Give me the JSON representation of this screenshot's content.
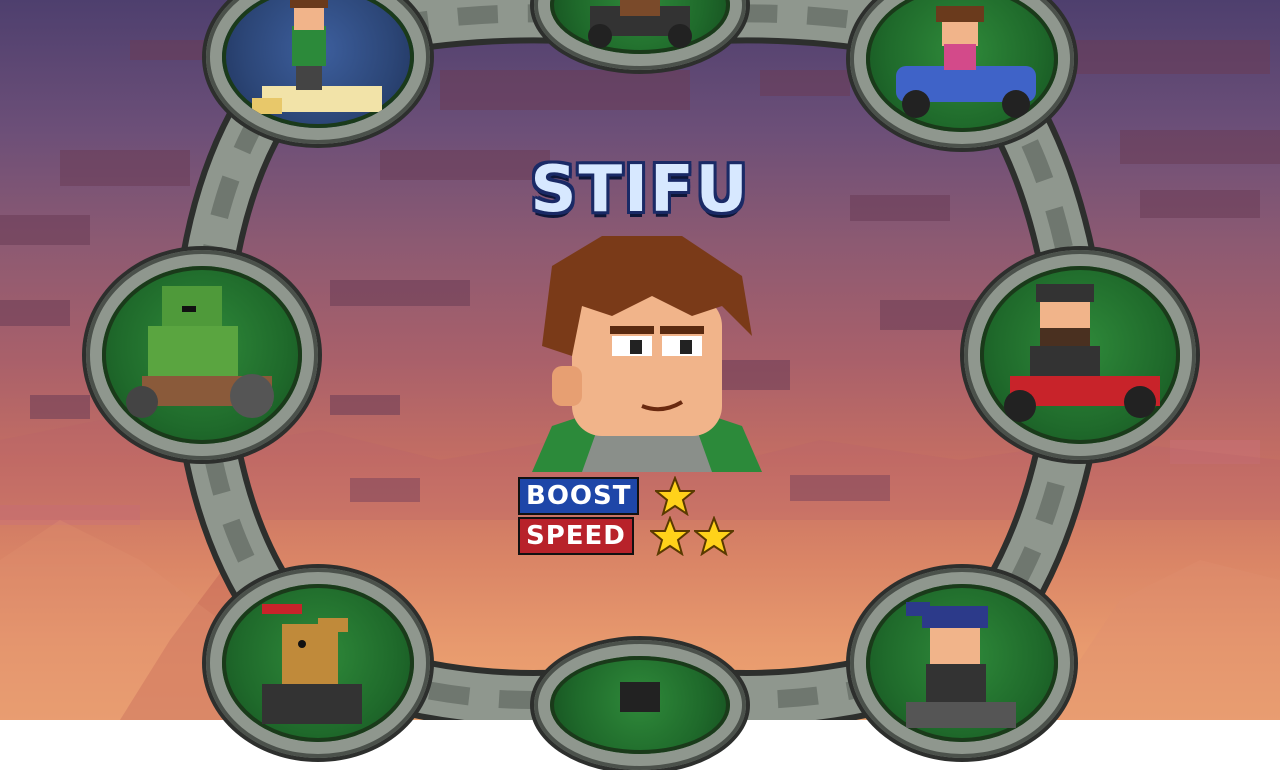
{
  "screen": "character-select",
  "selected_character": {
    "name": "STIFU",
    "stats": [
      {
        "label": "BOOST",
        "stars": 1,
        "label_color": "#1e46a8"
      },
      {
        "label": "SPEED",
        "stars": 2,
        "label_color": "#b8222a"
      }
    ]
  },
  "roster": [
    {
      "slot": "top-left",
      "character": "boy in yellow kart",
      "background": "blue",
      "icon": "character-portrait"
    },
    {
      "slot": "top-center",
      "character": "kart racer (partially hidden)",
      "background": "green",
      "icon": "character-portrait"
    },
    {
      "slot": "top-right",
      "character": "girl in blue kart",
      "background": "green",
      "icon": "character-portrait"
    },
    {
      "slot": "middle-left",
      "character": "green ogre in kart",
      "background": "green",
      "icon": "character-portrait"
    },
    {
      "slot": "middle-right",
      "character": "bearded man in red kart",
      "background": "green",
      "icon": "character-portrait"
    },
    {
      "slot": "bottom-left",
      "character": "goat in kart",
      "background": "green",
      "icon": "character-portrait"
    },
    {
      "slot": "bottom-center",
      "character": "racer (partially hidden)",
      "background": "green",
      "icon": "character-portrait"
    },
    {
      "slot": "bottom-right",
      "character": "blue-haired girl in kart",
      "background": "green",
      "icon": "character-portrait"
    }
  ],
  "colors": {
    "star": "#ffd21a",
    "slot_green": "#2f8a3a",
    "slot_blue": "#3d5f9e",
    "ring": "#8f978e"
  }
}
